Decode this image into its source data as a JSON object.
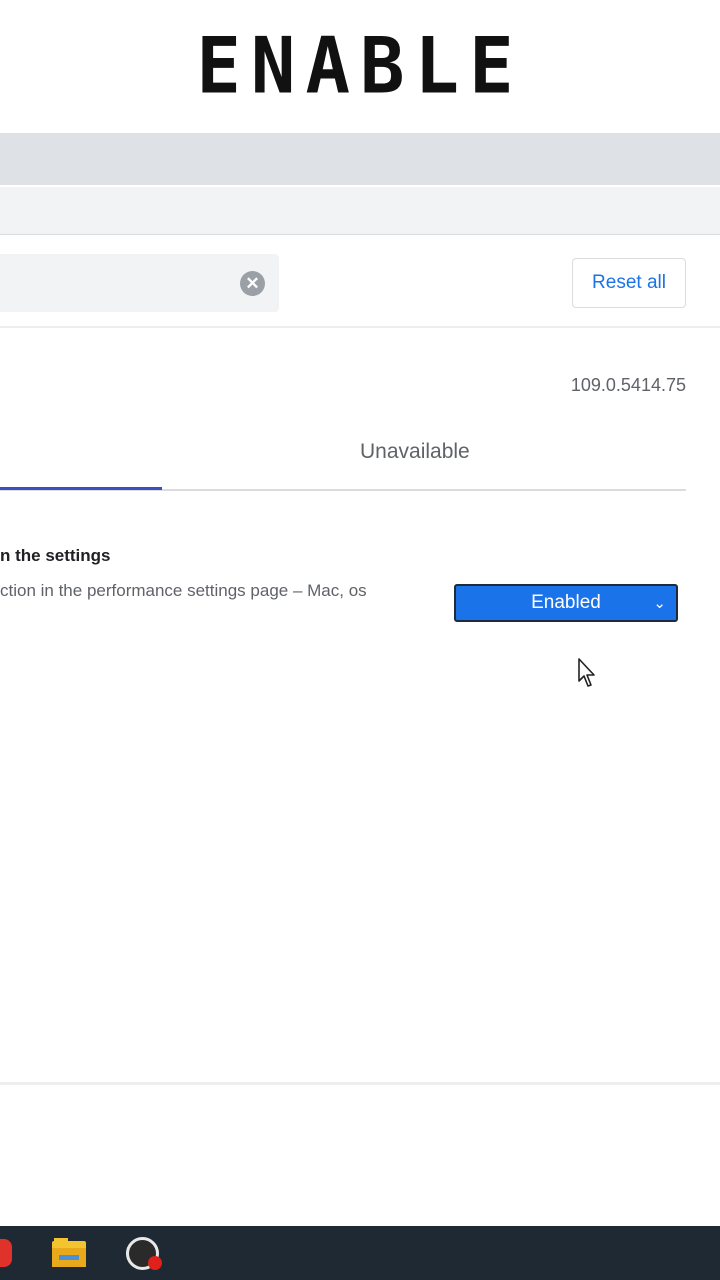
{
  "caption": {
    "text": "ENABLE"
  },
  "flags_header": {
    "clear_icon_glyph": "✕",
    "reset_all_label": "Reset all"
  },
  "version": "109.0.5414.75",
  "tabs": {
    "unavailable_label": "Unavailable"
  },
  "experiment": {
    "title": "n the settings",
    "description": "ction in the performance settings page – Mac, os",
    "select_value": "Enabled",
    "chevron_glyph": "⌄"
  },
  "colors": {
    "accent": "#1a73e8",
    "tab_indicator": "#3b4fc2",
    "taskbar": "#1f2933"
  },
  "taskbar_items": [
    "red-app-icon",
    "folder-icon",
    "obs-icon"
  ]
}
